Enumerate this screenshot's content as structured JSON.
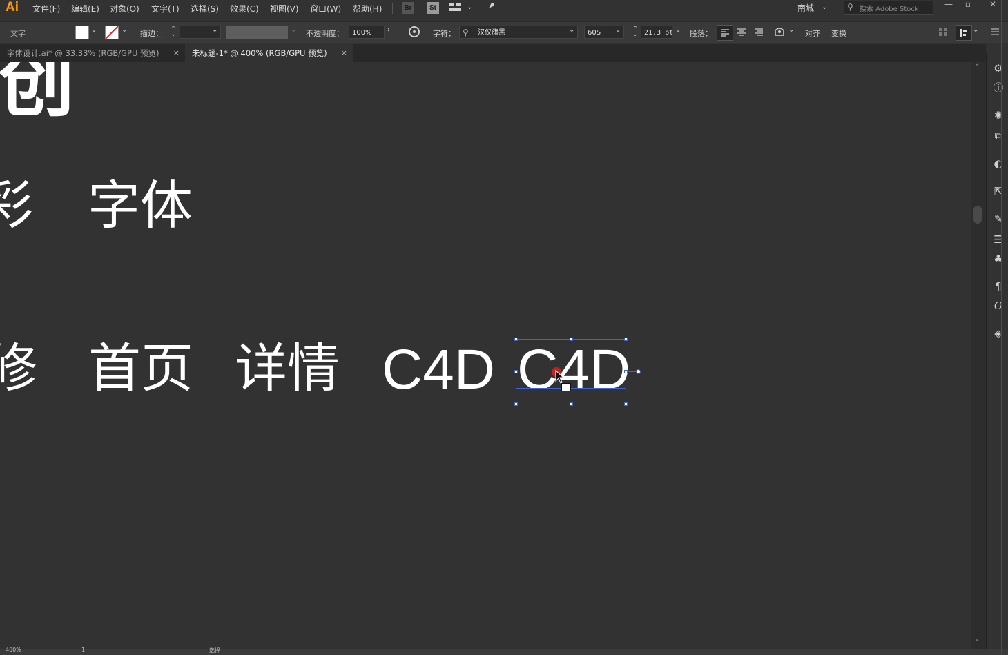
{
  "app": {
    "logo": "Ai"
  },
  "menu": {
    "items": [
      "文件(F)",
      "编辑(E)",
      "对象(O)",
      "文字(T)",
      "选择(S)",
      "效果(C)",
      "视图(V)",
      "窗口(W)",
      "帮助(H)"
    ],
    "bridge": "Br",
    "stock": "St",
    "workspace": "南城",
    "search_placeholder": "搜索 Adobe Stock"
  },
  "control": {
    "tool_label": "文字",
    "stroke_label": "描边：",
    "opacity_label": "不透明度：",
    "opacity_value": "100%",
    "char_label": "字符：",
    "font_name": "汉仪旗黑",
    "font_style": "60S",
    "font_size": "21.3 pt",
    "para_label": "段落：",
    "align_label": "对齐",
    "transform_label": "变换"
  },
  "tabs": [
    {
      "label": "字体设计.ai* @ 33.33% (RGB/GPU 预览)"
    },
    {
      "label": "未标题-1* @ 400% (RGB/GPU 预览)"
    }
  ],
  "canvas": {
    "row1": "创",
    "row2": [
      "彩",
      "字体"
    ],
    "row3": [
      "修",
      "首页",
      "详情",
      "C4D",
      "C4D"
    ]
  },
  "status": {
    "zoom": "400%",
    "page": "1",
    "tool": "选择"
  },
  "colors": {
    "menu_bg": "#323232",
    "canvas_bg": "#323232",
    "accent": "#ff9a00",
    "selection": "#3a63d6"
  }
}
